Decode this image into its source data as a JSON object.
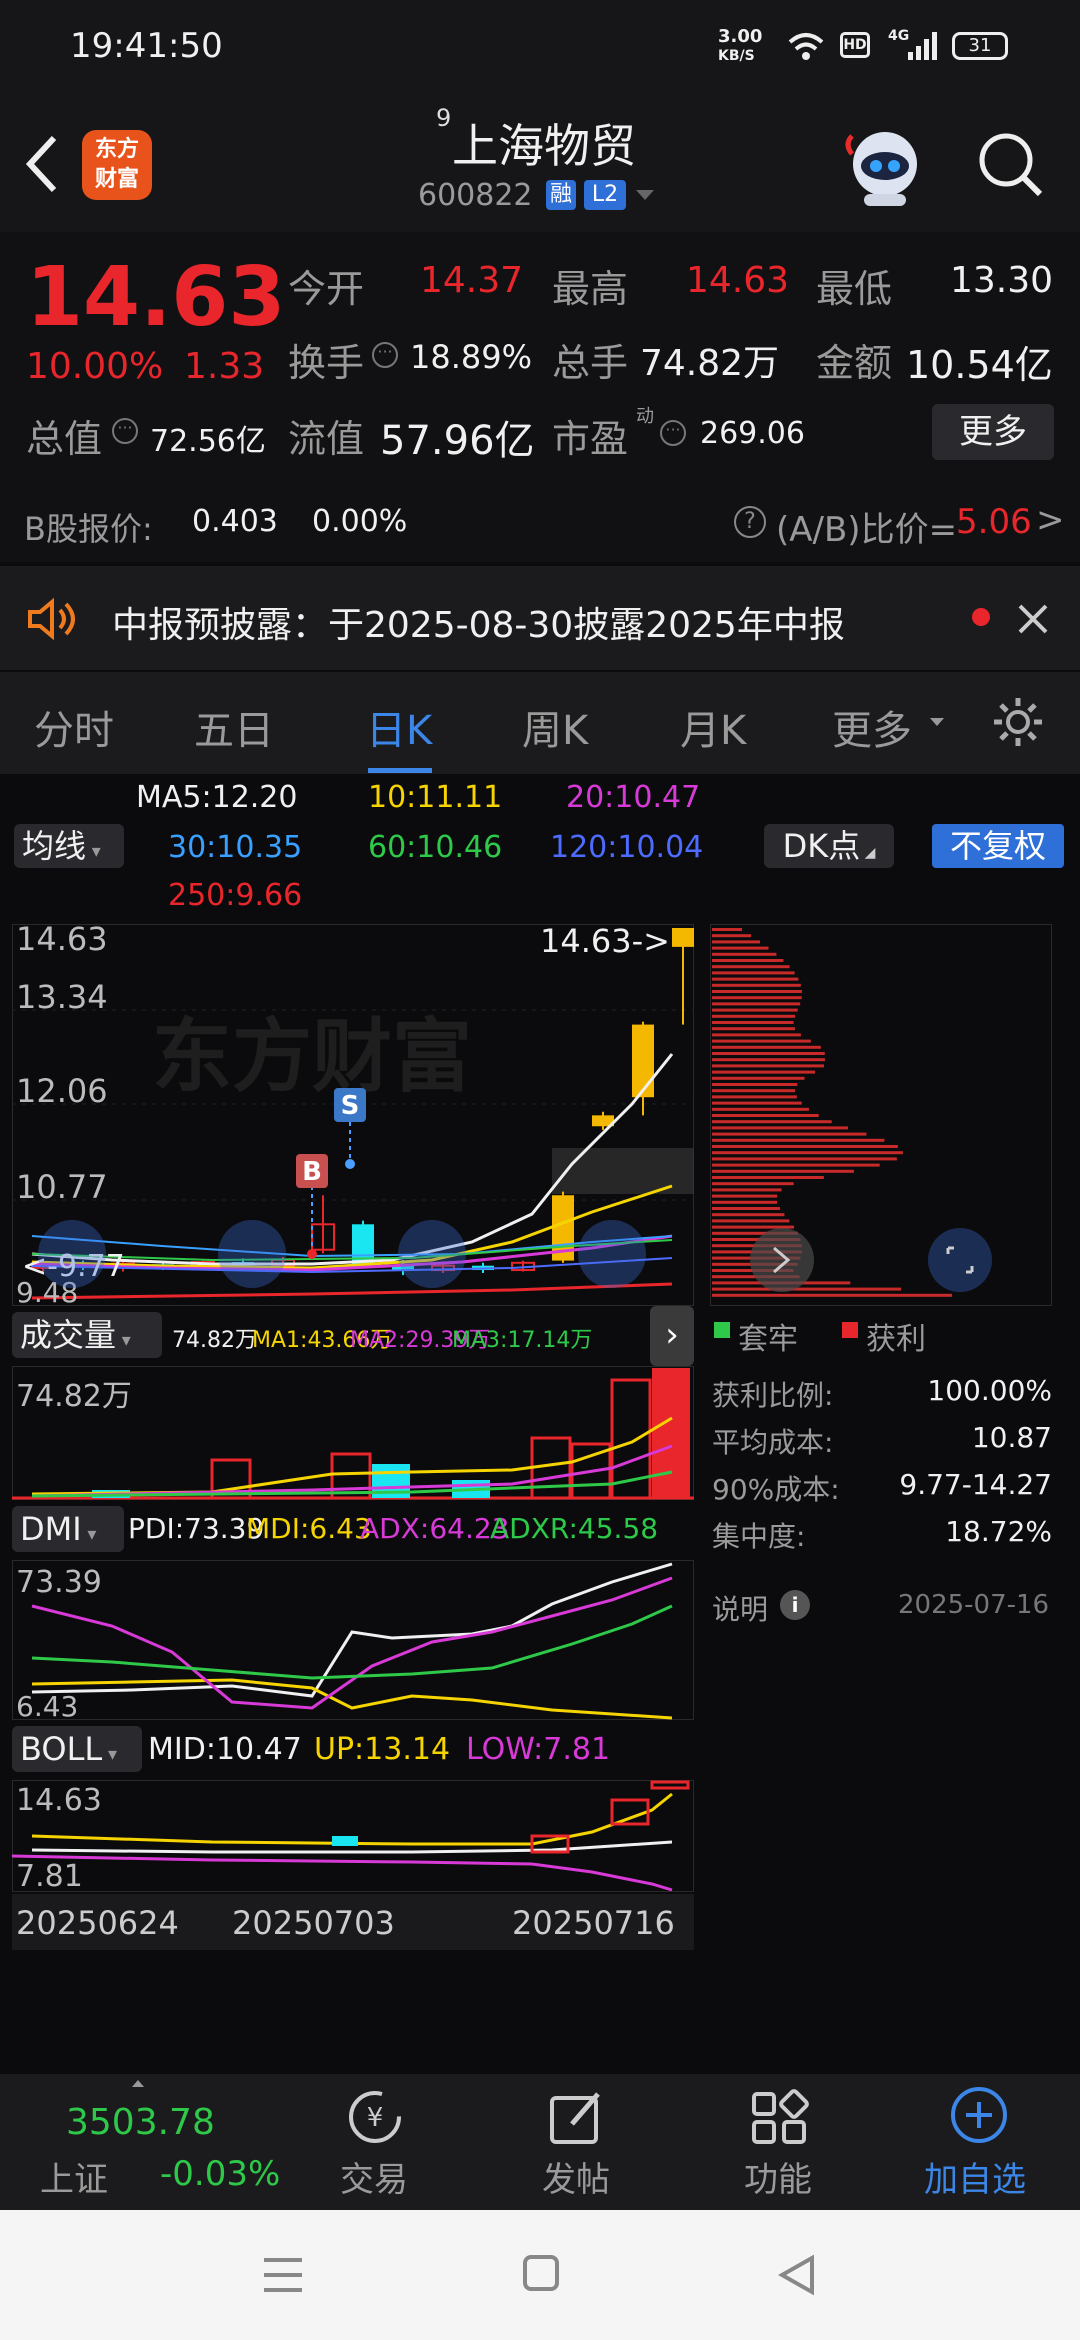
{
  "status_bar": {
    "time": "19:41:50",
    "net_speed_top": "3.00",
    "net_speed_unit": "KB/S",
    "battery": "31",
    "signal": "4G"
  },
  "header": {
    "logo_line1": "东方",
    "logo_line2": "财富",
    "superscript": "9",
    "name": "上海物贸",
    "code": "600822",
    "badge_rong": "融",
    "badge_l2": "L2"
  },
  "quote": {
    "price": "14.63",
    "pct": "10.00%",
    "change": "1.33",
    "open_label": "今开",
    "open": "14.37",
    "high_label": "最高",
    "high": "14.63",
    "low_label": "最低",
    "low": "13.30",
    "turnover_label": "换手",
    "turnover": "18.89%",
    "volume_label": "总手",
    "volume": "74.82万",
    "amount_label": "金额",
    "amount": "10.54亿",
    "mktcap_label": "总值",
    "mktcap": "72.56亿",
    "float_label": "流值",
    "float": "57.96亿",
    "pe_label": "市盈",
    "pe_sup": "动",
    "pe": "269.06",
    "more": "更多"
  },
  "bshare": {
    "label": "B股报价:",
    "price": "0.403",
    "pct": "0.00%",
    "ratio_label": "(A/B)比价=",
    "ratio": "5.06",
    "arrow": ">"
  },
  "banner": {
    "text": "中报预披露：于2025-08-30披露2025年中报"
  },
  "tabs": [
    "分时",
    "五日",
    "日K",
    "周K",
    "月K",
    "更多"
  ],
  "active_tab": "日K",
  "ma": {
    "selector": "均线",
    "ma5": "MA5:12.20",
    "ma10": "10:11.11",
    "ma20": "20:10.47",
    "ma30": "30:10.35",
    "ma60": "60:10.46",
    "ma120": "120:10.04",
    "ma250": "250:9.66",
    "dk": "DK点",
    "fq": "不复权"
  },
  "kchart": {
    "y_top": "14.63",
    "y2": "13.34",
    "y3": "12.06",
    "y4": "10.77",
    "y_bot": "9.48",
    "last_label": "14.63->",
    "low_marker": "9.77",
    "b_tag": "B",
    "s_tag": "S",
    "watermark": "东方财富"
  },
  "volume": {
    "selector": "成交量",
    "v": "74.82万",
    "ma1": "MA1:43.66万",
    "ma2": "MA2:29.39万",
    "ma3": "MA3:17.14万",
    "y_top": "74.82万"
  },
  "dmi": {
    "selector": "DMI",
    "pdi": "PDI:73.39",
    "mdi": "MDI:6.43",
    "adx": "ADX:64.23",
    "adxr": "ADXR:45.58",
    "y_top": "73.39",
    "y_bot": "6.43"
  },
  "boll": {
    "selector": "BOLL",
    "mid": "MID:10.47",
    "up": "UP:13.14",
    "low": "LOW:7.81",
    "y_top": "14.63",
    "y_bot": "7.81"
  },
  "dates": [
    "20250624",
    "20250703",
    "20250716"
  ],
  "chip": {
    "legend_trap": "套牢",
    "legend_profit": "获利",
    "rows": [
      {
        "label": "获利比例:",
        "value": "100.00%"
      },
      {
        "label": "平均成本:",
        "value": "10.87"
      },
      {
        "label": "90%成本:",
        "value": "9.77-14.27"
      },
      {
        "label": "集中度:",
        "value": "18.72%"
      }
    ],
    "note": "说明",
    "date": "2025-07-16"
  },
  "bottom_bar": {
    "index_value": "3503.78",
    "index_name": "上证",
    "index_pct": "-0.03%",
    "trade": "交易",
    "post": "发帖",
    "func": "功能",
    "add": "加自选"
  },
  "colors": {
    "up": "#e8262b",
    "down": "#2ec949",
    "accent": "#3b86e6",
    "candle_yellow": "#f5b800",
    "candle_cyan": "#19e6f0"
  },
  "chart_data": {
    "type": "candlestick",
    "candles": [
      {
        "o": 9.95,
        "c": 10.02,
        "h": 10.05,
        "l": 9.9
      },
      {
        "o": 10.0,
        "c": 9.98,
        "h": 10.05,
        "l": 9.92
      },
      {
        "o": 9.97,
        "c": 10.01,
        "h": 10.06,
        "l": 9.9
      },
      {
        "o": 10.0,
        "c": 9.96,
        "h": 10.03,
        "l": 9.92
      },
      {
        "o": 9.96,
        "c": 10.03,
        "h": 10.06,
        "l": 9.93
      },
      {
        "o": 10.03,
        "c": 9.98,
        "h": 10.08,
        "l": 9.95
      },
      {
        "o": 9.98,
        "c": 10.06,
        "h": 10.1,
        "l": 9.95
      },
      {
        "o": 10.2,
        "c": 10.55,
        "h": 10.95,
        "l": 10.15
      },
      {
        "o": 10.55,
        "c": 10.0,
        "h": 10.6,
        "l": 9.98
      },
      {
        "o": 9.98,
        "c": 9.92,
        "h": 10.06,
        "l": 9.85
      },
      {
        "o": 9.92,
        "c": 9.98,
        "h": 10.04,
        "l": 9.88
      },
      {
        "o": 9.98,
        "c": 9.92,
        "h": 10.02,
        "l": 9.88
      },
      {
        "o": 9.92,
        "c": 10.02,
        "h": 10.05,
        "l": 9.9
      },
      {
        "o": 10.05,
        "c": 10.95,
        "h": 11.0,
        "l": 10.02
      },
      {
        "o": 11.9,
        "c": 12.05,
        "h": 12.1,
        "l": 11.85
      },
      {
        "o": 12.3,
        "c": 13.3,
        "h": 13.34,
        "l": 12.05
      },
      {
        "o": 14.37,
        "c": 14.63,
        "h": 14.63,
        "l": 13.3
      }
    ]
  }
}
